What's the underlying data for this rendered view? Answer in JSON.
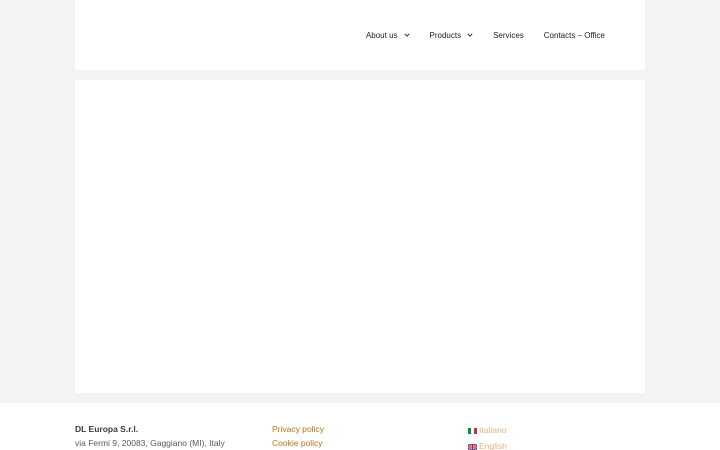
{
  "header": {
    "nav": [
      {
        "label": "About us",
        "has_dropdown": true
      },
      {
        "label": "Products",
        "has_dropdown": true
      },
      {
        "label": "Services",
        "has_dropdown": false
      },
      {
        "label": "Contacts – Office",
        "has_dropdown": false
      }
    ]
  },
  "footer": {
    "company_name": "DL Europa S.r.l.",
    "address": "via Fermi 9, 20083, Gaggiano (MI), Italy",
    "links": {
      "privacy": "Privacy policy",
      "cookie": "Cookie policy"
    },
    "languages": [
      {
        "label": "Italiano",
        "flag": "italy-flag-icon"
      },
      {
        "label": "English",
        "flag": "uk-flag-icon"
      }
    ]
  },
  "colors": {
    "background": "#f3f3f3",
    "panel": "#ffffff",
    "link": "#b8731e",
    "language_link": "#e0b48a"
  }
}
